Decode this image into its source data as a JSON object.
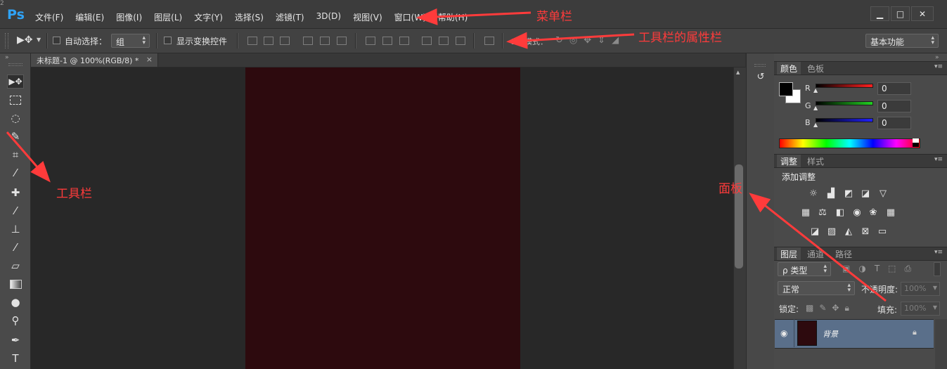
{
  "menubar": {
    "logo": "Ps",
    "items": [
      "文件(F)",
      "编辑(E)",
      "图像(I)",
      "图层(L)",
      "文字(Y)",
      "选择(S)",
      "滤镜(T)",
      "3D(D)",
      "视图(V)",
      "窗口(W)",
      "帮助(H)"
    ],
    "window_controls": {
      "minimize": "▁",
      "maximize": "□",
      "close": "✕"
    }
  },
  "options": {
    "auto_select_label": "自动选择：",
    "auto_select_value": "组",
    "show_transform_label": "显示变换控件",
    "mode_3d_label": "3D 模式：",
    "workspace_value": "基本功能"
  },
  "document_tab": {
    "title": "未标题-1 @ 100%(RGB/8) *",
    "close": "×"
  },
  "color_panel": {
    "tabs": [
      "颜色",
      "色板"
    ],
    "channels": [
      {
        "label": "R",
        "value": "0",
        "color": "#ff2020"
      },
      {
        "label": "G",
        "value": "0",
        "color": "#20d020"
      },
      {
        "label": "B",
        "value": "0",
        "color": "#2020ff"
      }
    ]
  },
  "adjustments_panel": {
    "tabs": [
      "调整",
      "样式"
    ],
    "heading": "添加调整",
    "icons_row1": [
      "brightness-icon",
      "levels-icon",
      "curves-icon",
      "exposure-icon",
      "vibrance-icon"
    ],
    "icons_row2": [
      "hue-saturation-icon",
      "color-balance-icon",
      "black-white-icon",
      "photo-filter-icon",
      "channel-mixer-icon",
      "color-lookup-icon"
    ],
    "icons_row3": [
      "invert-icon",
      "posterize-icon",
      "threshold-icon",
      "selective-color-icon",
      "gradient-map-icon"
    ]
  },
  "layers_panel": {
    "tabs": [
      "图层",
      "通道",
      "路径"
    ],
    "filter_label": "ρ 类型",
    "blend_mode": "正常",
    "opacity_label": "不透明度:",
    "opacity_value": "100%",
    "lock_label": "锁定:",
    "fill_label": "填充:",
    "fill_value": "100%",
    "layers": [
      {
        "name": "背景",
        "thumb_color": "#2d0a0e"
      }
    ]
  },
  "annotations": {
    "menu_bar": "菜单栏",
    "options_bar": "工具栏的属性栏",
    "toolbar": "工具栏",
    "panels": "面板",
    "color": "#ff3b3b"
  },
  "canvas": {
    "doc_color": "#2d0a0e"
  }
}
